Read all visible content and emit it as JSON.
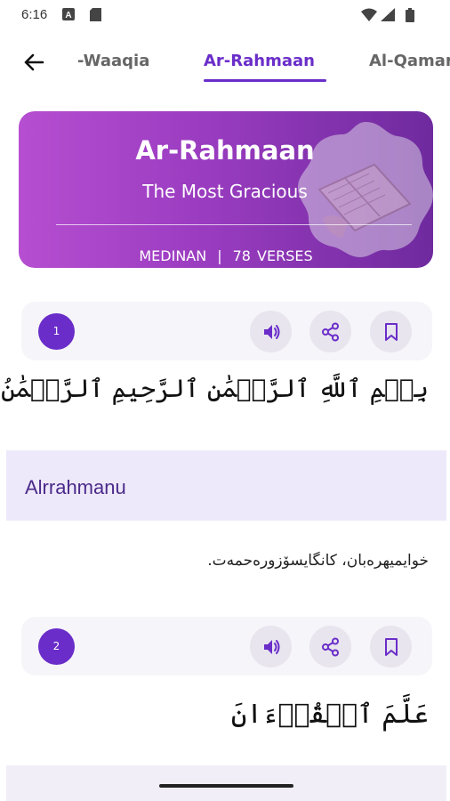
{
  "status_bar": {
    "time": "6:16",
    "icons": [
      "keyboard-a-icon",
      "sd-card-icon",
      "wifi-icon",
      "signal-icon",
      "battery-icon"
    ]
  },
  "header": {
    "back_icon": "arrow-left-icon",
    "tabs": [
      {
        "label": "-Waaqia",
        "active": false
      },
      {
        "label": "Ar-Rahmaan",
        "active": true
      },
      {
        "label": "Al-Qamar",
        "active": false
      }
    ]
  },
  "banner": {
    "title": "Ar-Rahmaan",
    "subtitle": "The Most Gracious",
    "revelation": "MEDINAN",
    "separator": "|",
    "verses": "78  VERSES",
    "art_icon": "quran-book-icon"
  },
  "verses": [
    {
      "number": "1",
      "arabic_bismillah": "بِسۡمِ ٱللَّهِ ٱلرَّحۡمَٰنِ ٱلرَّحِيمِ ٱلرَّحۡمَٰنُ",
      "transliteration": "Alrrahmanu",
      "translation": "خوایمیهرەبان، کانگایسۆزورەحمەت."
    },
    {
      "number": "2",
      "arabic": "عَلَّمَ ٱلۡقُرۡءَانَ"
    }
  ],
  "actions": {
    "play_icon": "speaker-icon",
    "share_icon": "share-icon",
    "bookmark_icon": "bookmark-icon"
  },
  "colors": {
    "accent": "#6a2dc9",
    "banner_start": "#b64ed1",
    "banner_end": "#6f2a9e",
    "translit_bg": "#eee9fa"
  }
}
